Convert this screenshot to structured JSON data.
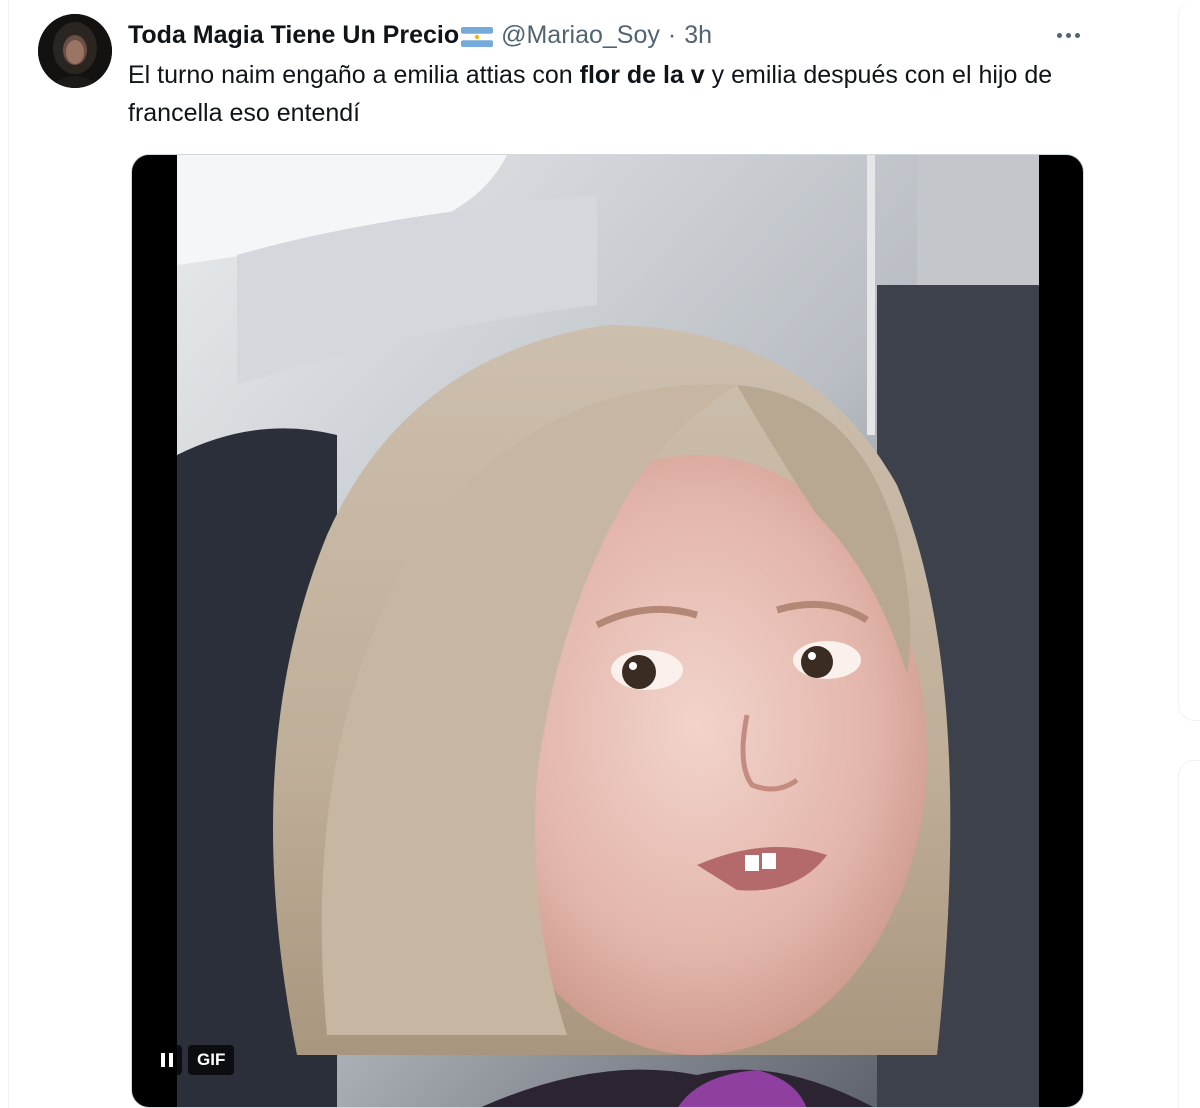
{
  "tweet": {
    "author": {
      "display_name": "Toda Magia Tiene Un Precio",
      "flag_icon": "argentina-flag-icon",
      "handle": "@Mariao_Soy",
      "separator": "·",
      "time": "3h"
    },
    "text_part1": "El turno naim engaño a emilia attias con ",
    "text_bold": "flor de la v",
    "text_part2": "  y emilia después con el hijo de francella eso entendí",
    "media": {
      "type": "gif",
      "badge": "GIF",
      "control_icon": "pause-icon"
    },
    "more_icon": "more-horizontal-icon"
  },
  "colors": {
    "primary_text": "#0f1419",
    "secondary_text": "#536471",
    "border": "#eff3f4"
  }
}
